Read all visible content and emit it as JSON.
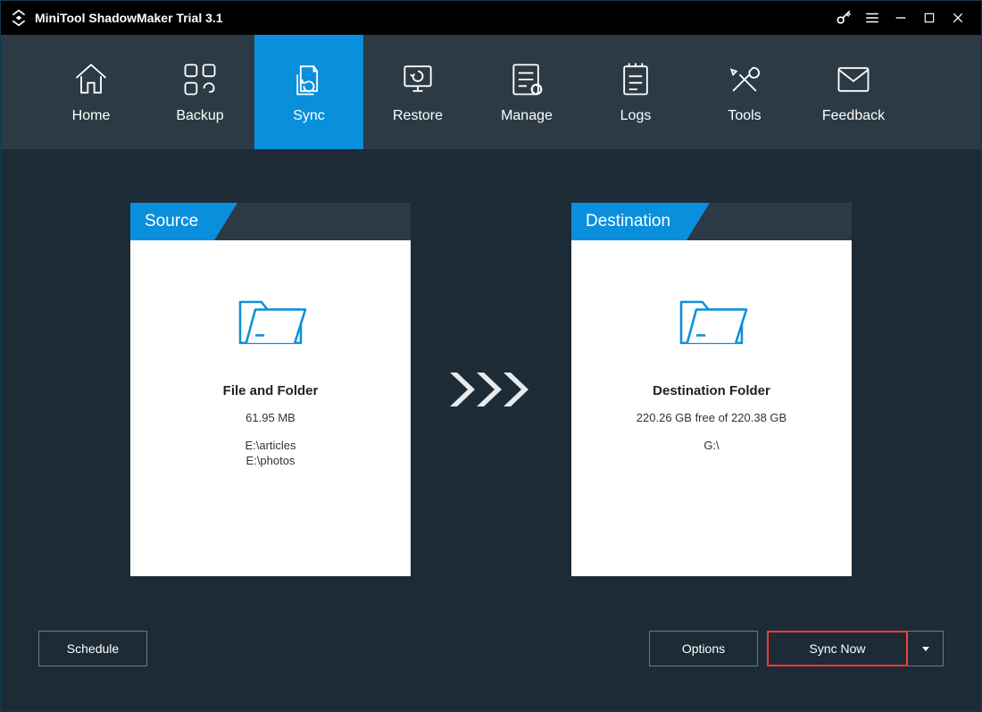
{
  "app": {
    "title": "MiniTool ShadowMaker Trial 3.1"
  },
  "nav": {
    "items": [
      {
        "label": "Home"
      },
      {
        "label": "Backup"
      },
      {
        "label": "Sync"
      },
      {
        "label": "Restore"
      },
      {
        "label": "Manage"
      },
      {
        "label": "Logs"
      },
      {
        "label": "Tools"
      },
      {
        "label": "Feedback"
      }
    ],
    "active_index": 2
  },
  "source": {
    "header": "Source",
    "title": "File and Folder",
    "size": "61.95 MB",
    "paths": [
      "E:\\articles",
      "E:\\photos"
    ]
  },
  "destination": {
    "header": "Destination",
    "title": "Destination Folder",
    "space": "220.26 GB free of 220.38 GB",
    "path": "G:\\"
  },
  "buttons": {
    "schedule": "Schedule",
    "options": "Options",
    "sync_now": "Sync Now"
  },
  "colors": {
    "accent": "#0a8fdd",
    "highlight": "#ff3a3a",
    "nav_bg": "#2b3a44",
    "window_bg": "#1c2b36"
  }
}
